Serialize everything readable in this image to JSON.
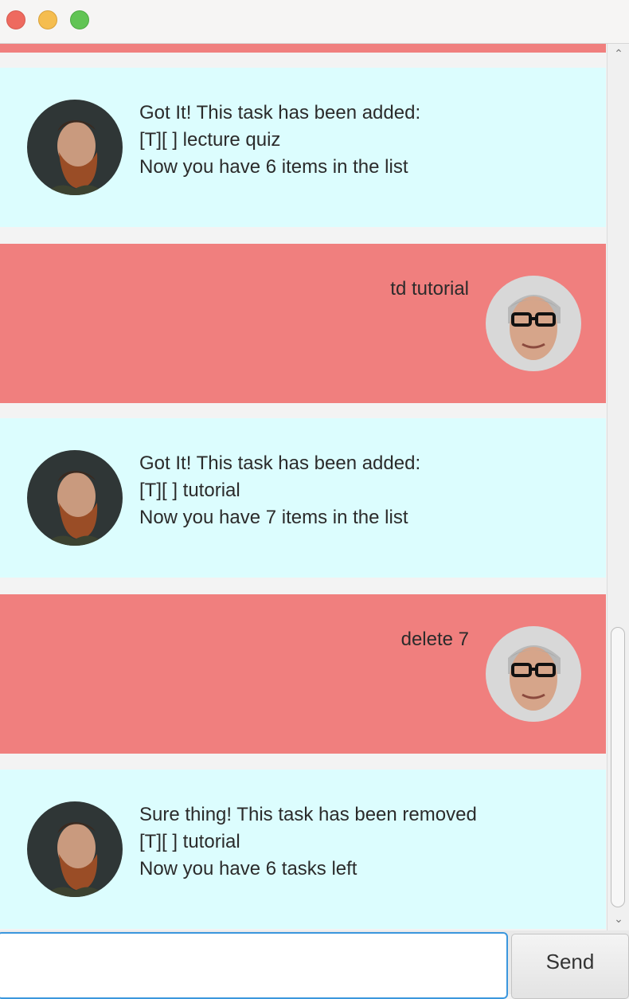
{
  "window": {
    "controls": [
      "close",
      "minimize",
      "maximize"
    ]
  },
  "dialog": [
    {
      "speaker": "bot",
      "avatar": "bearded-man-avatar",
      "text": "Got It! This task has been added:\n[T][ ] lecture quiz\nNow you have 6 items in the list"
    },
    {
      "speaker": "user",
      "avatar": "glasses-man-avatar",
      "text": "td tutorial"
    },
    {
      "speaker": "bot",
      "avatar": "bearded-man-avatar",
      "text": "Got It! This task has been added:\n[T][ ] tutorial\nNow you have 7 items in the list"
    },
    {
      "speaker": "user",
      "avatar": "glasses-man-avatar",
      "text": "delete 7"
    },
    {
      "speaker": "bot",
      "avatar": "bearded-man-avatar",
      "text": "Sure thing! This task has been removed\n[T][ ] tutorial\nNow you have 6 tasks left"
    }
  ],
  "input": {
    "value": "",
    "send_label": "Send"
  },
  "colors": {
    "bot_bg": "#dcfdfe",
    "user_bg": "#f07f7e",
    "focus": "#3b97dd"
  }
}
